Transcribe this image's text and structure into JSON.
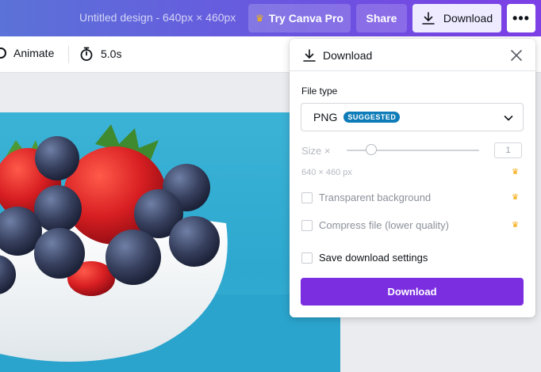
{
  "header": {
    "doc_title": "Untitled design - 640px × 460px",
    "try_pro_label": "Try Canva Pro",
    "share_label": "Share",
    "download_label": "Download",
    "more_label": "•••"
  },
  "toolbar": {
    "animate_label": "Animate",
    "duration_label": "5.0s"
  },
  "download_panel": {
    "title": "Download",
    "file_type_label": "File type",
    "file_type_value": "PNG",
    "suggested_badge": "SUGGESTED",
    "size_label": "Size ×",
    "size_value": "1",
    "dimensions_text": "640 × 460 px",
    "options": [
      {
        "label": "Transparent background",
        "pro": true
      },
      {
        "label": "Compress file (lower quality)",
        "pro": true
      },
      {
        "label": "Save download settings",
        "pro": false
      }
    ],
    "download_button_label": "Download"
  },
  "colors": {
    "accent": "#7b2ee0",
    "pro_crown": "#f5a600",
    "badge": "#0d7cb8"
  },
  "icons": [
    "crown-icon",
    "download-icon",
    "more-icon",
    "animate-icon",
    "timer-icon",
    "close-icon",
    "chevron-down-icon"
  ]
}
